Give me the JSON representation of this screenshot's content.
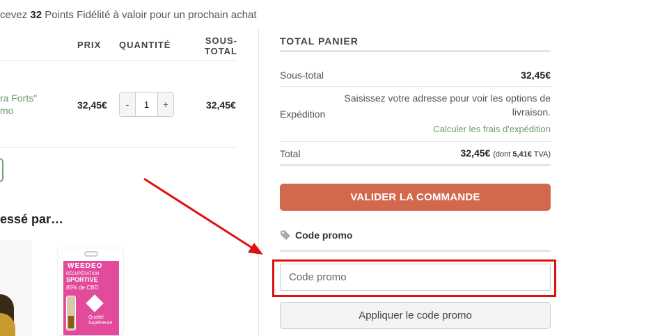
{
  "loyalty": {
    "prefix": "cevez ",
    "points": "32",
    "suffix": " Points Fidélité à valoir pour un prochain achat"
  },
  "cart_table": {
    "headers": {
      "price": "PRIX",
      "quantity": "QUANTITÉ",
      "subtotal": "SOUS-TOTAL"
    },
    "items": [
      {
        "name_line1": "ra Forts\"",
        "name_line2": "mo",
        "price": "32,45€",
        "quantity": "1",
        "subtotal": "32,45€"
      }
    ]
  },
  "cross_sells": {
    "title": "essé par…",
    "product2": {
      "brand": "WEEDEO",
      "line1": "RÉCUPÉRATION",
      "line2": "SPORTIVE",
      "line3": "85% de CBD",
      "quality": "Qualité Supérieure"
    }
  },
  "totals": {
    "title": "TOTAL PANIER",
    "subtotal_label": "Sous-total",
    "subtotal_value": "32,45€",
    "shipping_label": "Expédition",
    "shipping_note": "Saisissez votre adresse pour voir les options de livraison.",
    "shipping_link": "Calculer les frais d'expédition",
    "total_label": "Total",
    "total_value": "32,45€",
    "tax_prefix": "(dont ",
    "tax_value": "5,41€",
    "tax_suffix": " TVA)",
    "checkout_label": "VALIDER LA COMMANDE"
  },
  "promo": {
    "title": "Code promo",
    "placeholder": "Code promo",
    "apply_label": "Appliquer le code promo"
  },
  "colors": {
    "accent": "#d2694d",
    "link": "#6a9b6a",
    "annotation": "#e01010"
  },
  "icons": {
    "tag": "tag-icon",
    "plus": "plus-icon",
    "minus": "minus-icon"
  }
}
